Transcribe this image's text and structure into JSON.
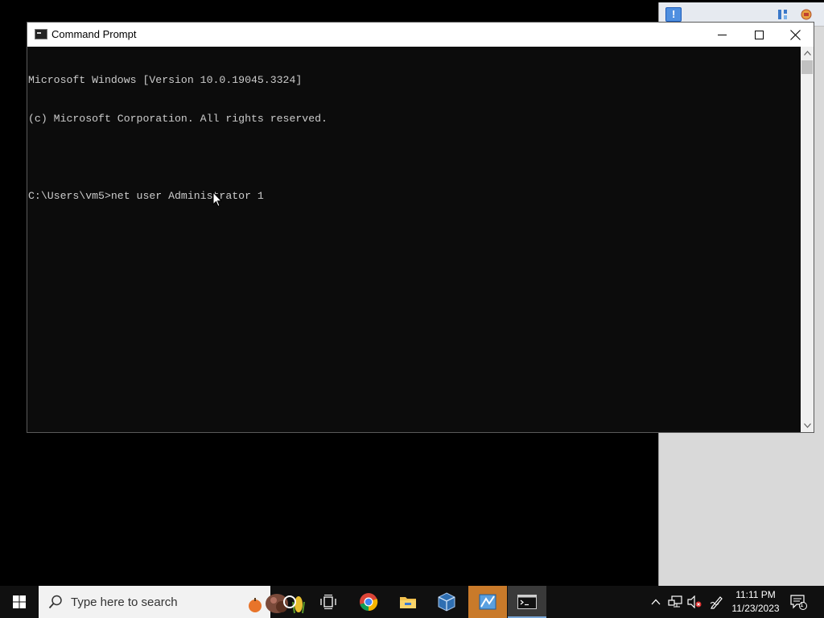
{
  "window": {
    "title": "Command Prompt",
    "icon": "cmd-icon",
    "controls": [
      "minimize-icon",
      "maximize-icon",
      "close-icon"
    ]
  },
  "console": {
    "lines": [
      "Microsoft Windows [Version 10.0.19045.3324]",
      "(c) Microsoft Corporation. All rights reserved.",
      "",
      "C:\\Users\\vm5>net user Administrator 1"
    ]
  },
  "taskbar": {
    "search_placeholder": "Type here to search",
    "apps": [
      "start-icon",
      "cortana-icon",
      "task-view-icon",
      "chrome-icon",
      "file-explorer-icon",
      "virtualbox-icon",
      "network-tool-icon",
      "cmd-icon"
    ],
    "clock": {
      "time": "11:11 PM",
      "date": "11/23/2023"
    },
    "notification_count": "1"
  },
  "colors": {
    "console_bg": "#0c0c0c",
    "console_text": "#cccccc",
    "taskbar_bg": "#101010",
    "highlight": "#c97a2a"
  }
}
